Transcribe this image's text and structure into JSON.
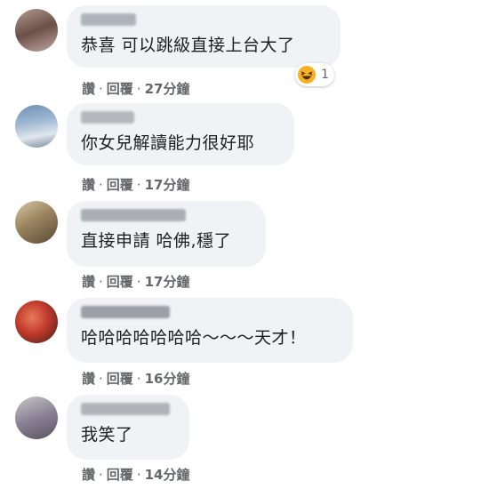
{
  "comments": [
    {
      "text": "恭喜 可以跳級直接上台大了",
      "actions": {
        "like": "讚",
        "reply": "回覆",
        "time": "27分鐘"
      },
      "reaction": {
        "icon": "haha-emoji-icon",
        "count": "1"
      }
    },
    {
      "text": "你女兒解讀能力很好耶",
      "actions": {
        "like": "讚",
        "reply": "回覆",
        "time": "17分鐘"
      }
    },
    {
      "text": "直接申請 哈佛,穩了",
      "actions": {
        "like": "讚",
        "reply": "回覆",
        "time": "17分鐘"
      }
    },
    {
      "text": "哈哈哈哈哈哈哈～～～天才！",
      "actions": {
        "like": "讚",
        "reply": "回覆",
        "time": "16分鐘"
      }
    },
    {
      "text": "我笑了",
      "actions": {
        "like": "讚",
        "reply": "回覆",
        "time": "14分鐘"
      }
    }
  ],
  "colors": {
    "bubble": "#f0f2f5",
    "text": "#1c1e21",
    "meta": "#65676b",
    "reaction_emoji": "#f7b125"
  }
}
